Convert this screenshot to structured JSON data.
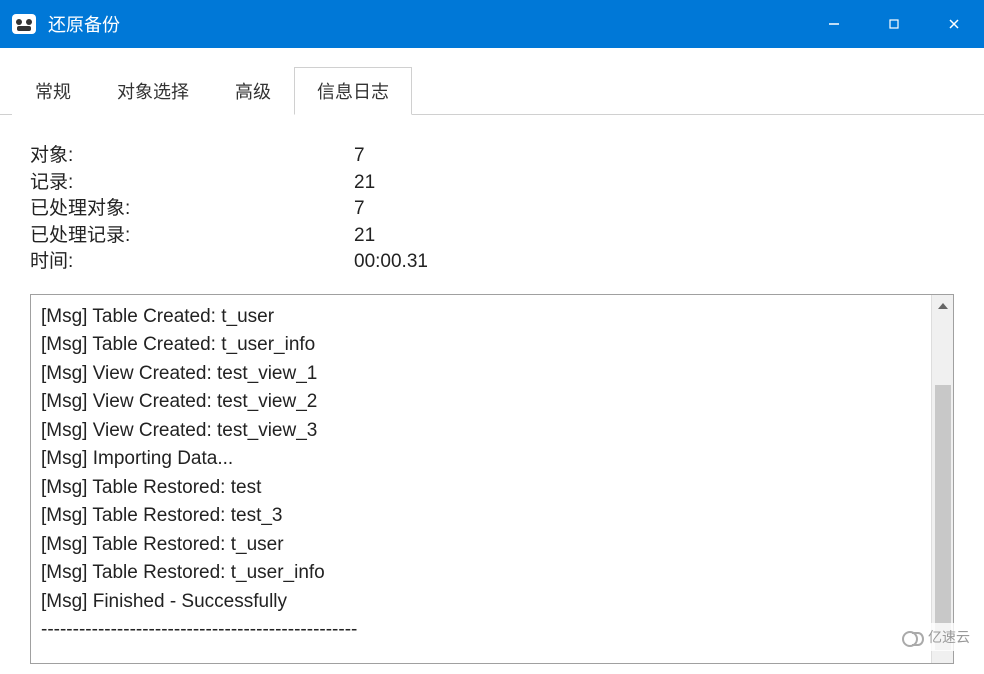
{
  "window": {
    "title": "还原备份"
  },
  "tabs": {
    "items": [
      {
        "label": "常规",
        "active": false
      },
      {
        "label": "对象选择",
        "active": false
      },
      {
        "label": "高级",
        "active": false
      },
      {
        "label": "信息日志",
        "active": true
      }
    ]
  },
  "stats": {
    "rows": [
      {
        "label": "对象:",
        "value": "7"
      },
      {
        "label": "记录:",
        "value": "21"
      },
      {
        "label": "已处理对象:",
        "value": "7"
      },
      {
        "label": "已处理记录:",
        "value": "21"
      },
      {
        "label": "时间:",
        "value": "00:00.31"
      }
    ]
  },
  "log": {
    "lines": [
      "[Msg] Table Created: t_user",
      "[Msg] Table Created: t_user_info",
      "[Msg] View Created: test_view_1",
      "[Msg] View Created: test_view_2",
      "[Msg] View Created: test_view_3",
      "[Msg] Importing Data...",
      "[Msg] Table Restored: test",
      "[Msg] Table Restored: test_3",
      "[Msg] Table Restored: t_user",
      "[Msg] Table Restored: t_user_info",
      "[Msg] Finished - Successfully",
      "--------------------------------------------------"
    ]
  },
  "watermark": {
    "text": "亿速云"
  }
}
